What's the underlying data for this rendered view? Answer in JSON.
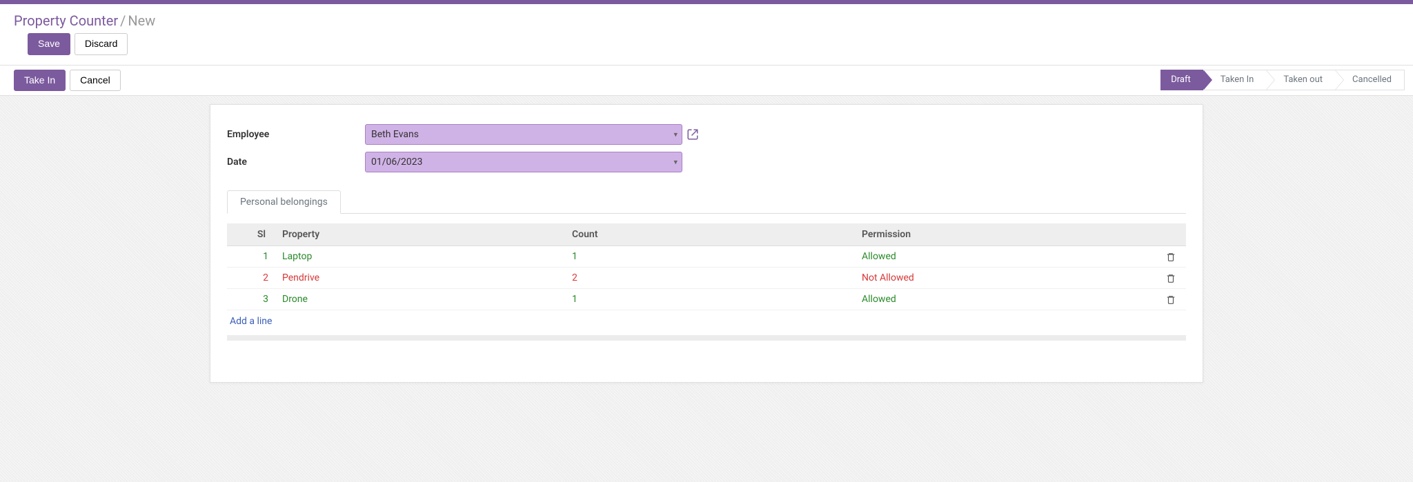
{
  "breadcrumb": {
    "root": "Property Counter",
    "current": "New"
  },
  "toolbar": {
    "save": "Save",
    "discard": "Discard",
    "take_in": "Take In",
    "cancel": "Cancel"
  },
  "status": {
    "stages": [
      "Draft",
      "Taken In",
      "Taken out",
      "Cancelled"
    ],
    "active_index": 0
  },
  "form": {
    "employee_label": "Employee",
    "employee_value": "Beth Evans",
    "date_label": "Date",
    "date_value": "01/06/2023"
  },
  "tabs": {
    "items": [
      "Personal belongings"
    ],
    "active_index": 0
  },
  "table": {
    "headers": {
      "sl": "Sl",
      "property": "Property",
      "count": "Count",
      "permission": "Permission"
    },
    "rows": [
      {
        "sl": "1",
        "property": "Laptop",
        "count": "1",
        "permission": "Allowed",
        "allowed": true
      },
      {
        "sl": "2",
        "property": "Pendrive",
        "count": "2",
        "permission": "Not Allowed",
        "allowed": false
      },
      {
        "sl": "3",
        "property": "Drone",
        "count": "1",
        "permission": "Allowed",
        "allowed": true
      }
    ],
    "add_line": "Add a line"
  }
}
